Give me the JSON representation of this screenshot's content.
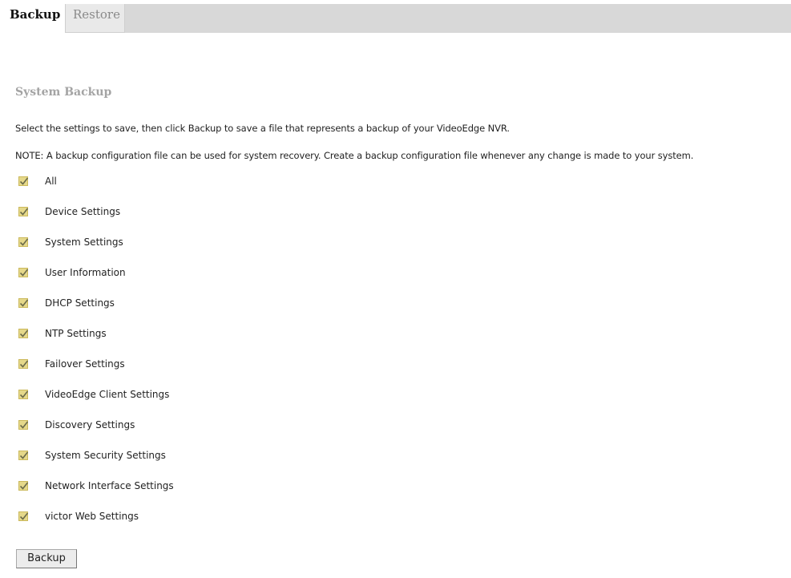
{
  "tabs": {
    "backup": "Backup",
    "restore": "Restore"
  },
  "section": {
    "title": "System Backup",
    "instructions": "Select the settings to save, then click Backup to save a file that represents a backup of your VideoEdge NVR.",
    "note": "NOTE: A backup configuration file can be used for system recovery. Create a backup configuration file whenever any change is made to your system."
  },
  "options": [
    {
      "label": "All",
      "checked": true
    },
    {
      "label": "Device Settings",
      "checked": true
    },
    {
      "label": "System Settings",
      "checked": true
    },
    {
      "label": "User Information",
      "checked": true
    },
    {
      "label": "DHCP Settings",
      "checked": true
    },
    {
      "label": "NTP Settings",
      "checked": true
    },
    {
      "label": "Failover Settings",
      "checked": true
    },
    {
      "label": "VideoEdge Client Settings",
      "checked": true
    },
    {
      "label": "Discovery Settings",
      "checked": true
    },
    {
      "label": "System Security Settings",
      "checked": true
    },
    {
      "label": "Network Interface Settings",
      "checked": true
    },
    {
      "label": "victor Web Settings",
      "checked": true
    }
  ],
  "actions": {
    "backup_label": "Backup"
  },
  "colors": {
    "tabbar_bg": "#d8d8d8",
    "section_title": "#a4a4a4",
    "checkbox_fill": "#e5d88a",
    "checkmark": "#6b6b4a"
  },
  "icons": {
    "checkbox": "checkmark-icon"
  }
}
